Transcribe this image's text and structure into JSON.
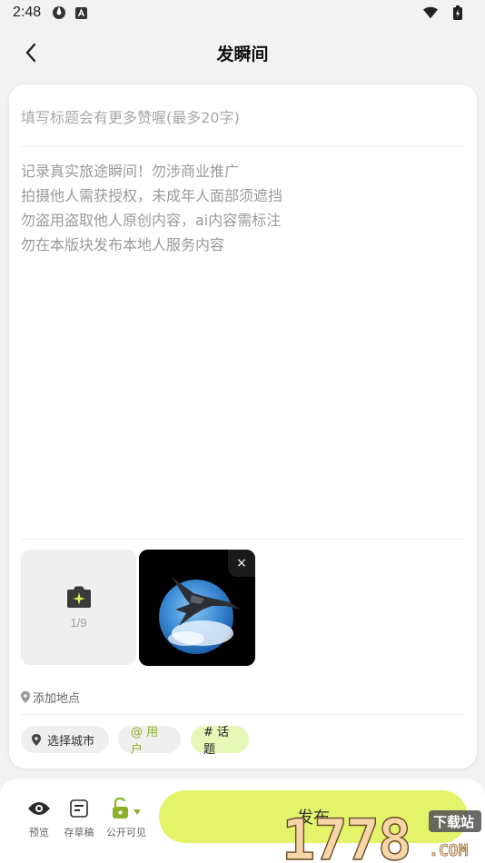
{
  "status_bar": {
    "time": "2:48",
    "icons": [
      "sync-icon",
      "app-notification-icon",
      "wifi-icon",
      "battery-icon"
    ]
  },
  "header": {
    "title": "发瞬间",
    "back_icon": "chevron-left-icon"
  },
  "editor": {
    "title_placeholder": "填写标题会有更多赞喔(最多20字)",
    "body_placeholder": "记录真实旅途瞬间！勿涉商业推广\n拍摄他人需获授权，未成年人面部须遮挡\n勿盗用盗取他人原创内容，ai内容需标注\n勿在本版块发布本地人服务内容"
  },
  "media": {
    "add_icon": "camera-sparkle-icon",
    "count": "1/9",
    "close_symbol": "×"
  },
  "location": {
    "label": "添加地点",
    "icon": "location-pin-icon"
  },
  "chips": {
    "city": "选择城市",
    "user": "@ 用户",
    "topic": "# 话题"
  },
  "bottom_bar": {
    "preview_label": "预览",
    "draft_label": "存草稿",
    "visibility_label": "公开可见",
    "publish_label": "发布"
  },
  "watermark": {
    "text_main": "1778",
    "text_tag": "下载站",
    "text_domain": ".COM"
  },
  "colors": {
    "accent": "#e3f36a",
    "topic_chip": "#e6f7b7",
    "user_chip_text": "#8bb22a",
    "lock_green": "#8bb22a",
    "background": "#f2f2f2"
  }
}
